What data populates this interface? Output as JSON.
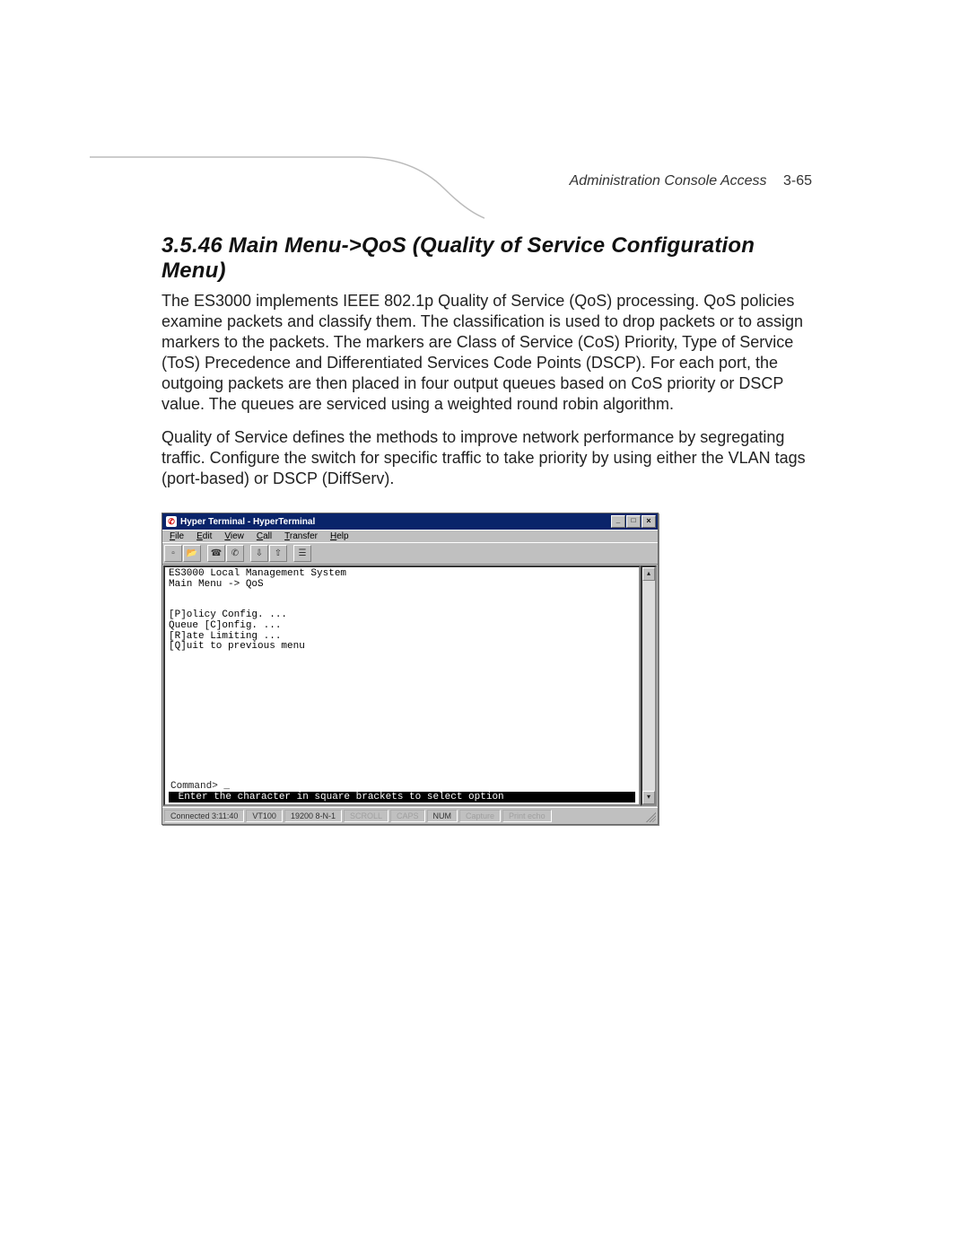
{
  "header": {
    "breadcrumb": "Administration Console Access",
    "page_number": "3-65"
  },
  "section": {
    "heading": "3.5.46  Main Menu->QoS (Quality of Service Configuration Menu)",
    "para1": "The ES3000 implements IEEE 802.1p Quality of Service (QoS) processing. QoS policies examine packets and classify them. The classification is used to drop packets or to assign markers to the packets. The markers are Class of Service (CoS) Priority, Type of Service (ToS) Precedence and Differentiated Services Code Points (DSCP). For each port, the outgoing packets are then placed in four output queues based on CoS priority or DSCP value. The queues are serviced using a weighted round robin algorithm.",
    "para2": "Quality of Service defines the methods to improve network performance by segregating traffic. Configure the switch for specific traffic to take priority by using either the VLAN tags (port-based) or DSCP (DiffServ)."
  },
  "ht": {
    "title": "Hyper Terminal - HyperTerminal",
    "menus": [
      "File",
      "Edit",
      "View",
      "Call",
      "Transfer",
      "Help"
    ],
    "terminal": {
      "line1": "ES3000 Local Management System",
      "line2": "Main Menu -> QoS",
      "opt1": "[P]olicy Config. ...",
      "opt2": "Queue [C]onfig. ...",
      "opt3": "[R]ate Limiting ...",
      "opt4": "[Q]uit to previous menu",
      "prompt": "Command> _",
      "banner": " Enter the character in square brackets to select option"
    },
    "status": {
      "conn": "Connected 3:11:40",
      "emul": "VT100",
      "line": "19200 8-N-1",
      "scroll": "SCROLL",
      "caps": "CAPS",
      "num": "NUM",
      "capture": "Capture",
      "echo": "Print echo"
    }
  }
}
